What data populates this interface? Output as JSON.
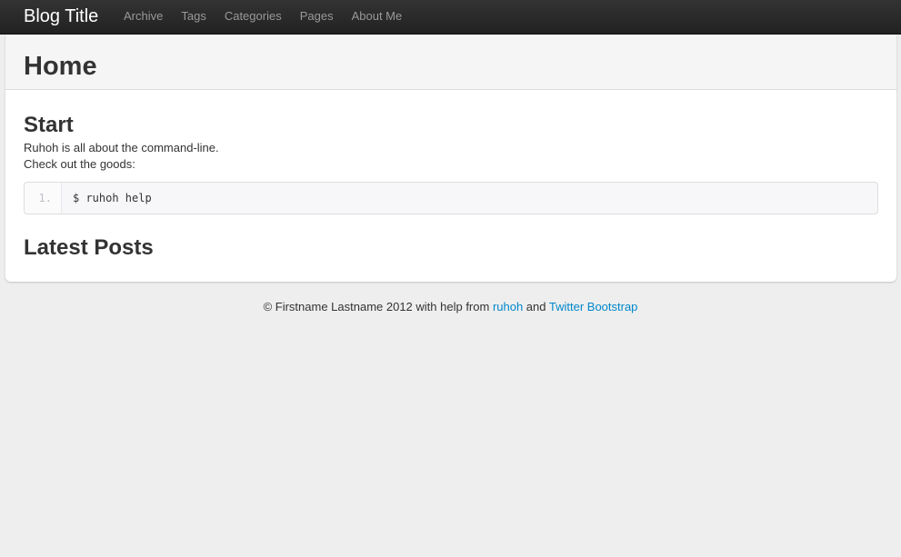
{
  "navbar": {
    "brand": "Blog Title",
    "items": [
      {
        "label": "Archive"
      },
      {
        "label": "Tags"
      },
      {
        "label": "Categories"
      },
      {
        "label": "Pages"
      },
      {
        "label": "About Me"
      }
    ]
  },
  "page": {
    "title": "Home",
    "start_heading": "Start",
    "line1": "Ruhoh is all about the command-line.",
    "line2": "Check out the goods:",
    "code": {
      "line_number": "1.",
      "text": "$ ruhoh help"
    },
    "latest_heading": "Latest Posts"
  },
  "footer": {
    "prefix": "© Firstname Lastname 2012 with help from ",
    "link1": "ruhoh",
    "middle": " and ",
    "link2": "Twitter Bootstrap"
  },
  "colors": {
    "navbar_bg": "#222222",
    "link": "#0088cc",
    "page_bg": "#eeeeee"
  }
}
